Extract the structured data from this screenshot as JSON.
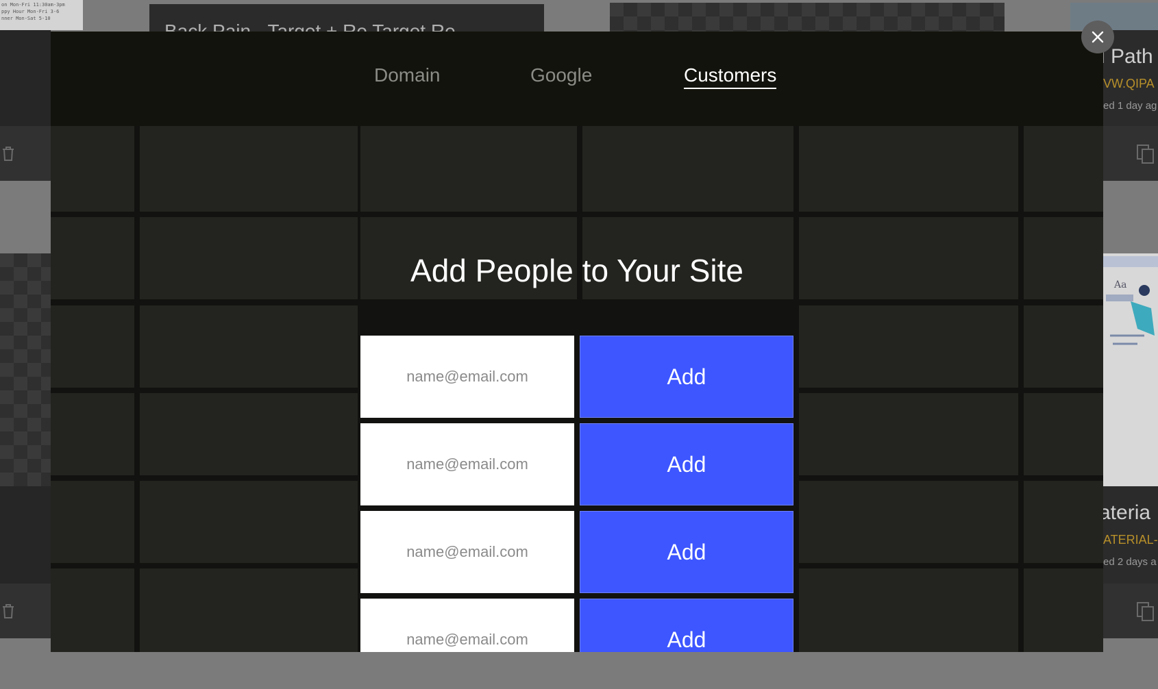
{
  "background": {
    "card_title_partial": "Back Pain - Target + Re  Target Re",
    "right_card_1": {
      "title_fragment": "i Path",
      "url_fragment": "VW.QIPA",
      "meta_fragment": "ed 1 day ag"
    },
    "right_card_2": {
      "title_fragment": "ateria",
      "url_fragment": "ATERIAL-H",
      "meta_fragment": "ed 2 days a"
    },
    "tiny_text_lines": [
      "on Mon-Fri 11:30am-3pm",
      "ppy Hour Mon-Fri 3-6",
      "nner Mon-Sat 5-10"
    ]
  },
  "modal": {
    "tabs": [
      {
        "label": "Domain",
        "active": false
      },
      {
        "label": "Google",
        "active": false
      },
      {
        "label": "Customers",
        "active": true
      }
    ],
    "title": "Add People to Your Site",
    "rows": [
      {
        "placeholder": "name@email.com",
        "button_label": "Add"
      },
      {
        "placeholder": "name@email.com",
        "button_label": "Add"
      },
      {
        "placeholder": "name@email.com",
        "button_label": "Add"
      },
      {
        "placeholder": "name@email.com",
        "button_label": "Add"
      }
    ],
    "close_icon": "close-icon"
  },
  "colors": {
    "accent": "#3d56ff",
    "modal_header": "#13130d",
    "modal_body": "#1c1c18",
    "overlay": "#7b7b7b"
  }
}
